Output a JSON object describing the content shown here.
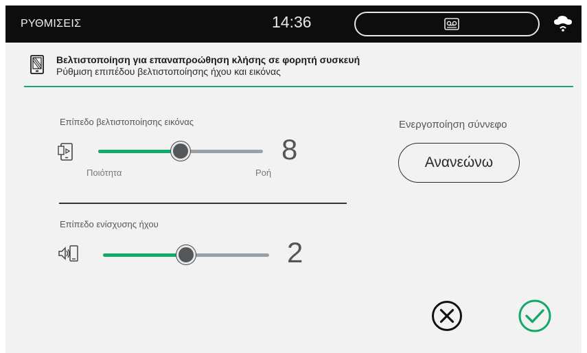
{
  "topbar": {
    "title": "ΡΥΘΜΙΣΕΙΣ",
    "clock": "14:36",
    "message_icon": "voicemail-icon",
    "cloud_icon": "cloud-wifi-icon"
  },
  "header": {
    "icon": "mobile-device-icon",
    "title": "Βελτιστοποίηση για επαναπροώθηση κλήσης σε φορητή συσκευή",
    "subtitle": "Ρύθμιση επιπέδου βελτιστοποίησης ήχου και εικόνας"
  },
  "image_optimization": {
    "label": "Επίπεδο βελτιστοποίησης εικόνας",
    "icon": "video-phone-icon",
    "value": "8",
    "level_fraction": 0.5,
    "min_label": "Ποιότητα",
    "max_label": "Ροή"
  },
  "audio_boost": {
    "label": "Επίπεδο ενίσχυσης ήχου",
    "icon": "speaker-phone-icon",
    "value": "2",
    "level_fraction": 0.5
  },
  "cloud": {
    "label": "Ενεργοποίηση σύννεφο",
    "button_label": "Ανανεώνω"
  },
  "actions": {
    "cancel_icon": "close-circle-icon",
    "confirm_icon": "check-circle-icon"
  },
  "colors": {
    "accent": "#14a86a",
    "track": "#9aa1a6",
    "topbar_bg": "#0d0d0d",
    "panel_bg": "#f2f2f2"
  }
}
